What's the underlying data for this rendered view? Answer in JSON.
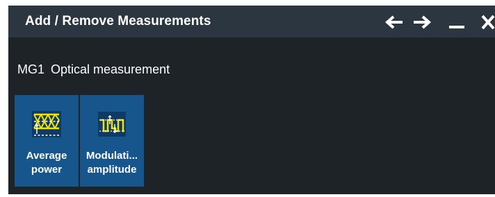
{
  "dialog": {
    "title": "Add / Remove Measurements",
    "icons": {
      "back": "arrow-left-icon",
      "forward": "arrow-right-icon",
      "minimize": "minimize-icon",
      "close": "close-icon"
    }
  },
  "group": {
    "id": "MG1",
    "name": "Optical measurement"
  },
  "measurements": [
    {
      "line1": "Average",
      "line2": "power",
      "icon": "average-power-icon"
    },
    {
      "line1": "Modulati...",
      "line2": "amplitude",
      "icon": "modulation-amplitude-icon"
    }
  ],
  "colors": {
    "background": "#1e2328",
    "titlebar": "#2b3641",
    "tile": "#17568c",
    "icon_accent": "#f2e300"
  }
}
